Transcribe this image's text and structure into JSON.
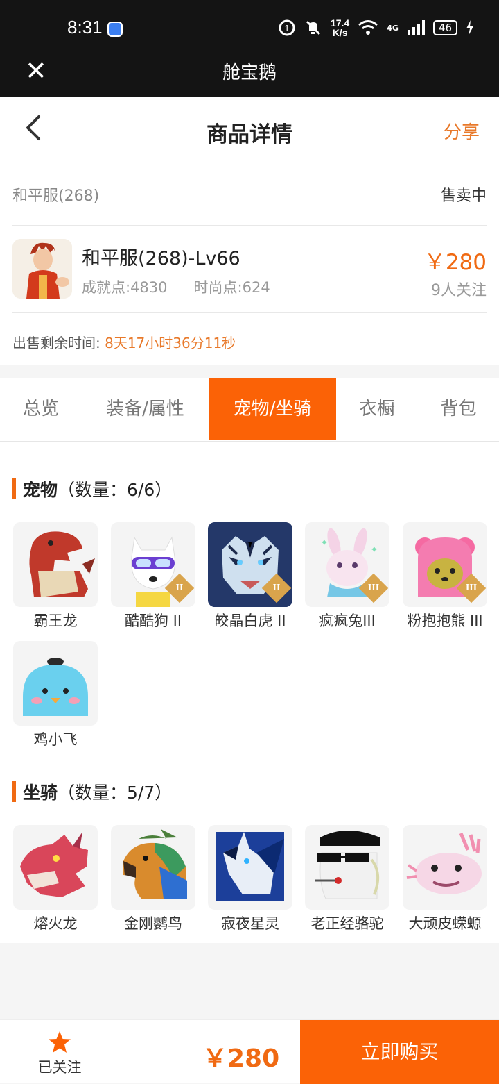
{
  "status_bar": {
    "time": "8:31",
    "speed_value": "17.4",
    "speed_unit": "K/s",
    "network": "4G",
    "battery": "46"
  },
  "title_bar": {
    "title": "舱宝鹅"
  },
  "nav": {
    "title": "商品详情",
    "share": "分享"
  },
  "listing": {
    "server": "和平服(268)",
    "status": "售卖中",
    "account_name": "和平服(268)-Lv66",
    "achievement": "成就点:4830",
    "fashion": "时尚点:624",
    "price": "￥280",
    "followers": "9人关注",
    "remaining_label": "出售剩余时间:",
    "remaining_value": "8天17小时36分11秒"
  },
  "tabs": [
    {
      "label": "总览"
    },
    {
      "label": "装备/属性"
    },
    {
      "label": "宠物/坐骑",
      "active": true
    },
    {
      "label": "衣橱"
    },
    {
      "label": "背包"
    }
  ],
  "pets": {
    "title": "宠物",
    "count": "（数量：6/6）",
    "items": [
      {
        "name": "霸王龙"
      },
      {
        "name": "酷酷狗 II",
        "badge": "II"
      },
      {
        "name": "皎晶白虎 II",
        "badge": "II"
      },
      {
        "name": "疯疯兔III",
        "badge": "III"
      },
      {
        "name": "粉抱抱熊 III",
        "badge": "III"
      },
      {
        "name": "鸡小飞"
      }
    ]
  },
  "mounts": {
    "title": "坐骑",
    "count": "（数量：5/7）",
    "items": [
      {
        "name": "熔火龙"
      },
      {
        "name": "金刚鹦鸟"
      },
      {
        "name": "寂夜星灵"
      },
      {
        "name": "老正经骆驼"
      },
      {
        "name": "大顽皮蝾螈"
      }
    ]
  },
  "bottom": {
    "followed": "已关注",
    "price": "￥280",
    "buy": "立即购买"
  },
  "colors": {
    "accent": "#fb6206",
    "price": "#f06a13"
  }
}
